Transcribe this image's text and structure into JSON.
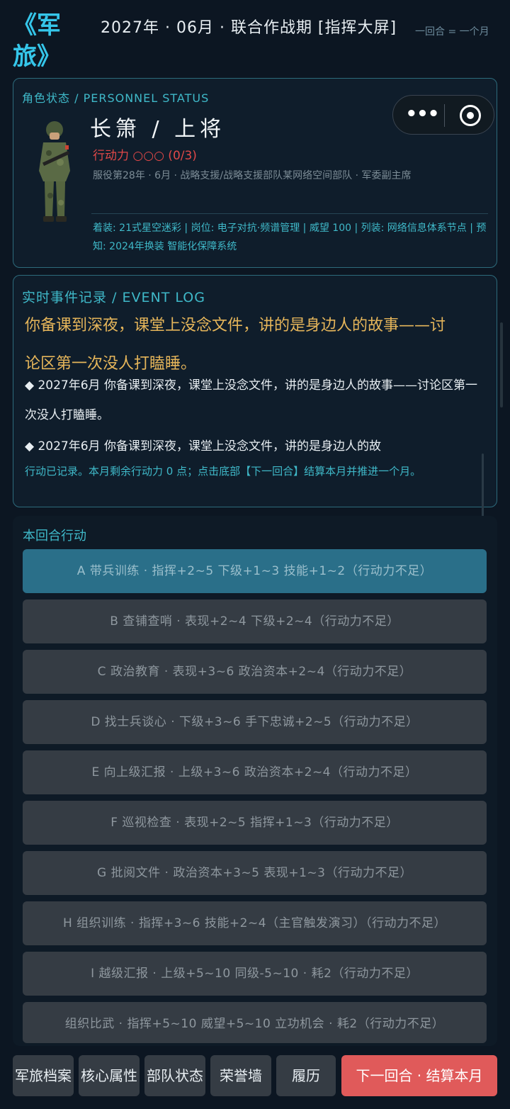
{
  "header": {
    "logo": "《军旅》",
    "date_line": "2027年 · 06月 · 联合作战期 [指挥大屏]",
    "round_note": "一回合 = 一个月"
  },
  "status": {
    "title": "角色状态 / PERSONNEL STATUS",
    "name_line": "长箫 / 上将",
    "action_points": "行动力 ○○○ (0/3)",
    "service_line": "服役第28年 · 6月 · 战略支援/战略支援部队某网络空间部队 · 军委副主席",
    "equip_line": "着装: 21式星空迷彩 | 岗位: 电子对抗·频谱管理 | 威望 100 | 列装: 网络信息体系节点 | 预知: 2024年换装 智能化保障系统",
    "avatar_icon": "soldier-avatar"
  },
  "event_log": {
    "title": "实时事件记录 / EVENT LOG",
    "highlight": "你备课到深夜，课堂上没念文件，讲的是身边人的故事——讨论区第一次没人打瞌睡。",
    "entry1": "◆ 2027年6月 你备课到深夜，课堂上没念文件，讲的是身边人的故事——讨论区第一次没人打瞌睡。",
    "entry2": "◆ 2027年6月 你备课到深夜，课堂上没念文件，讲的是身边人的故",
    "note": "行动已记录。本月剩余行动力 0 点；点击底部【下一回合】结算本月并推进一个月。"
  },
  "actions": {
    "title": "本回合行动",
    "items": [
      {
        "label": "A  带兵训练 · 指挥+2~5 下级+1~3 技能+1~2（行动力不足）"
      },
      {
        "label": "B  查铺查哨 · 表现+2~4 下级+2~4（行动力不足）"
      },
      {
        "label": "C  政治教育 · 表现+3~6 政治资本+2~4（行动力不足）"
      },
      {
        "label": "D  找士兵谈心 · 下级+3~6 手下忠诚+2~5（行动力不足）"
      },
      {
        "label": "E  向上级汇报 · 上级+3~6 政治资本+2~4（行动力不足）"
      },
      {
        "label": "F  巡视检查 · 表现+2~5 指挥+1~3（行动力不足）"
      },
      {
        "label": "G  批阅文件 · 政治资本+3~5 表现+1~3（行动力不足）"
      },
      {
        "label": "H  组织训练 · 指挥+3~6 技能+2~4（主官触发演习）（行动力不足）"
      },
      {
        "label": "I  越级汇报 · 上级+5~10 同级-5~10 · 耗2（行动力不足）"
      },
      {
        "label": "组织比武 · 指挥+5~10 威望+5~10 立功机会 · 耗2（行动力不足）"
      }
    ]
  },
  "nav": {
    "archive": "军旅档案",
    "attributes": "核心属性",
    "unit": "部队状态",
    "honor": "荣誉墙",
    "resume": "履历",
    "next_round": "下一回合 · 结算本月"
  },
  "colors": {
    "accent": "#3fb9c9",
    "warning": "#e04848",
    "highlight": "#e5b55a",
    "primary_button": "#e05a5a"
  }
}
